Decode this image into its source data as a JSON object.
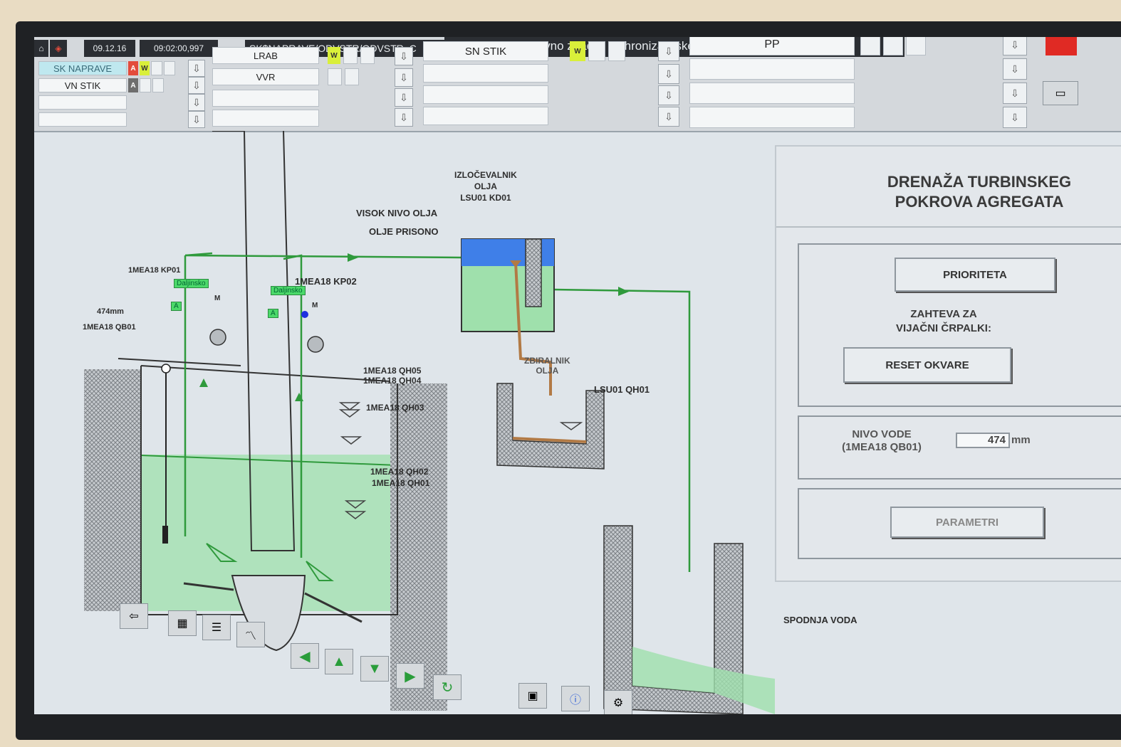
{
  "alarm_bar": {
    "date": "09.12.16",
    "time": "09:02:00,997",
    "path": "SK$NAPRAVE/ODVSTR/ODVSTR_C",
    "message": "Razlika med časovno značko sinhronizacijskega",
    "rows": [
      {
        "label": "SK NAPRAVE",
        "badges": [
          "A",
          "W"
        ]
      },
      {
        "label": "VN STIK",
        "badges": [
          "A"
        ]
      },
      {
        "label": "",
        "badges": []
      },
      {
        "label": "",
        "badges": []
      }
    ],
    "col2": [
      {
        "label": "LRAB",
        "badge": "W"
      },
      {
        "label": "VVR",
        "badge": ""
      },
      {
        "label": "",
        "badge": ""
      },
      {
        "label": "",
        "badge": ""
      }
    ],
    "col3": [
      {
        "label": "SN STIK",
        "badge": "W"
      },
      {
        "label": "",
        "badge": ""
      },
      {
        "label": "",
        "badge": ""
      },
      {
        "label": "",
        "badge": ""
      }
    ],
    "col4": [
      {
        "label": "PP",
        "badge": ""
      },
      {
        "label": "",
        "badge": ""
      },
      {
        "label": "",
        "badge": ""
      },
      {
        "label": "",
        "badge": ""
      }
    ]
  },
  "diagram": {
    "separator_title": [
      "IZLOČEVALNIK",
      "OLJA",
      "LSU01 KD01"
    ],
    "visok_nivo": "VISOK NIVO OLJA",
    "olje_prisono": "OLJE PRISONO",
    "pump1": {
      "id": "1MEA18 KP01",
      "mode": "Daljinsko",
      "auto": "A",
      "motor": "M"
    },
    "pump2": {
      "id": "1MEA18 KP02",
      "mode": "Daljinsko",
      "auto": "A",
      "motor": "M"
    },
    "level_value": "474mm",
    "level_sensor": "1MEA18 QB01",
    "switches": [
      "1MEA18 QH05",
      "1MEA18 QH04",
      "1MEA18 QH03",
      "1MEA18 QH02",
      "1MEA18 QH01"
    ],
    "collector_title": [
      "ZBIRALNIK",
      "OLJA"
    ],
    "collector_switch": "LSU01 QH01",
    "spodnja_voda": "SPODNJA VODA"
  },
  "panel": {
    "title": [
      "DRENAŽA TURBINSKEG",
      "POKROVA AGREGATA"
    ],
    "prioriteta": "PRIORITETA",
    "zahteva": [
      "ZAHTEVA ZA",
      "VIJAČNI ČRPALKI:"
    ],
    "reset": "RESET OKVARE",
    "nivo_label": [
      "NIVO VODE",
      "(1MEA18 QB01)"
    ],
    "nivo_value": "474",
    "nivo_unit": "mm",
    "parametri": "PARAMETRI"
  },
  "colors": {
    "green_line": "#2f9a3c",
    "water": "#9fe0ac",
    "oil_blue": "#3f7fe8",
    "oil_brown": "#b27a45"
  }
}
